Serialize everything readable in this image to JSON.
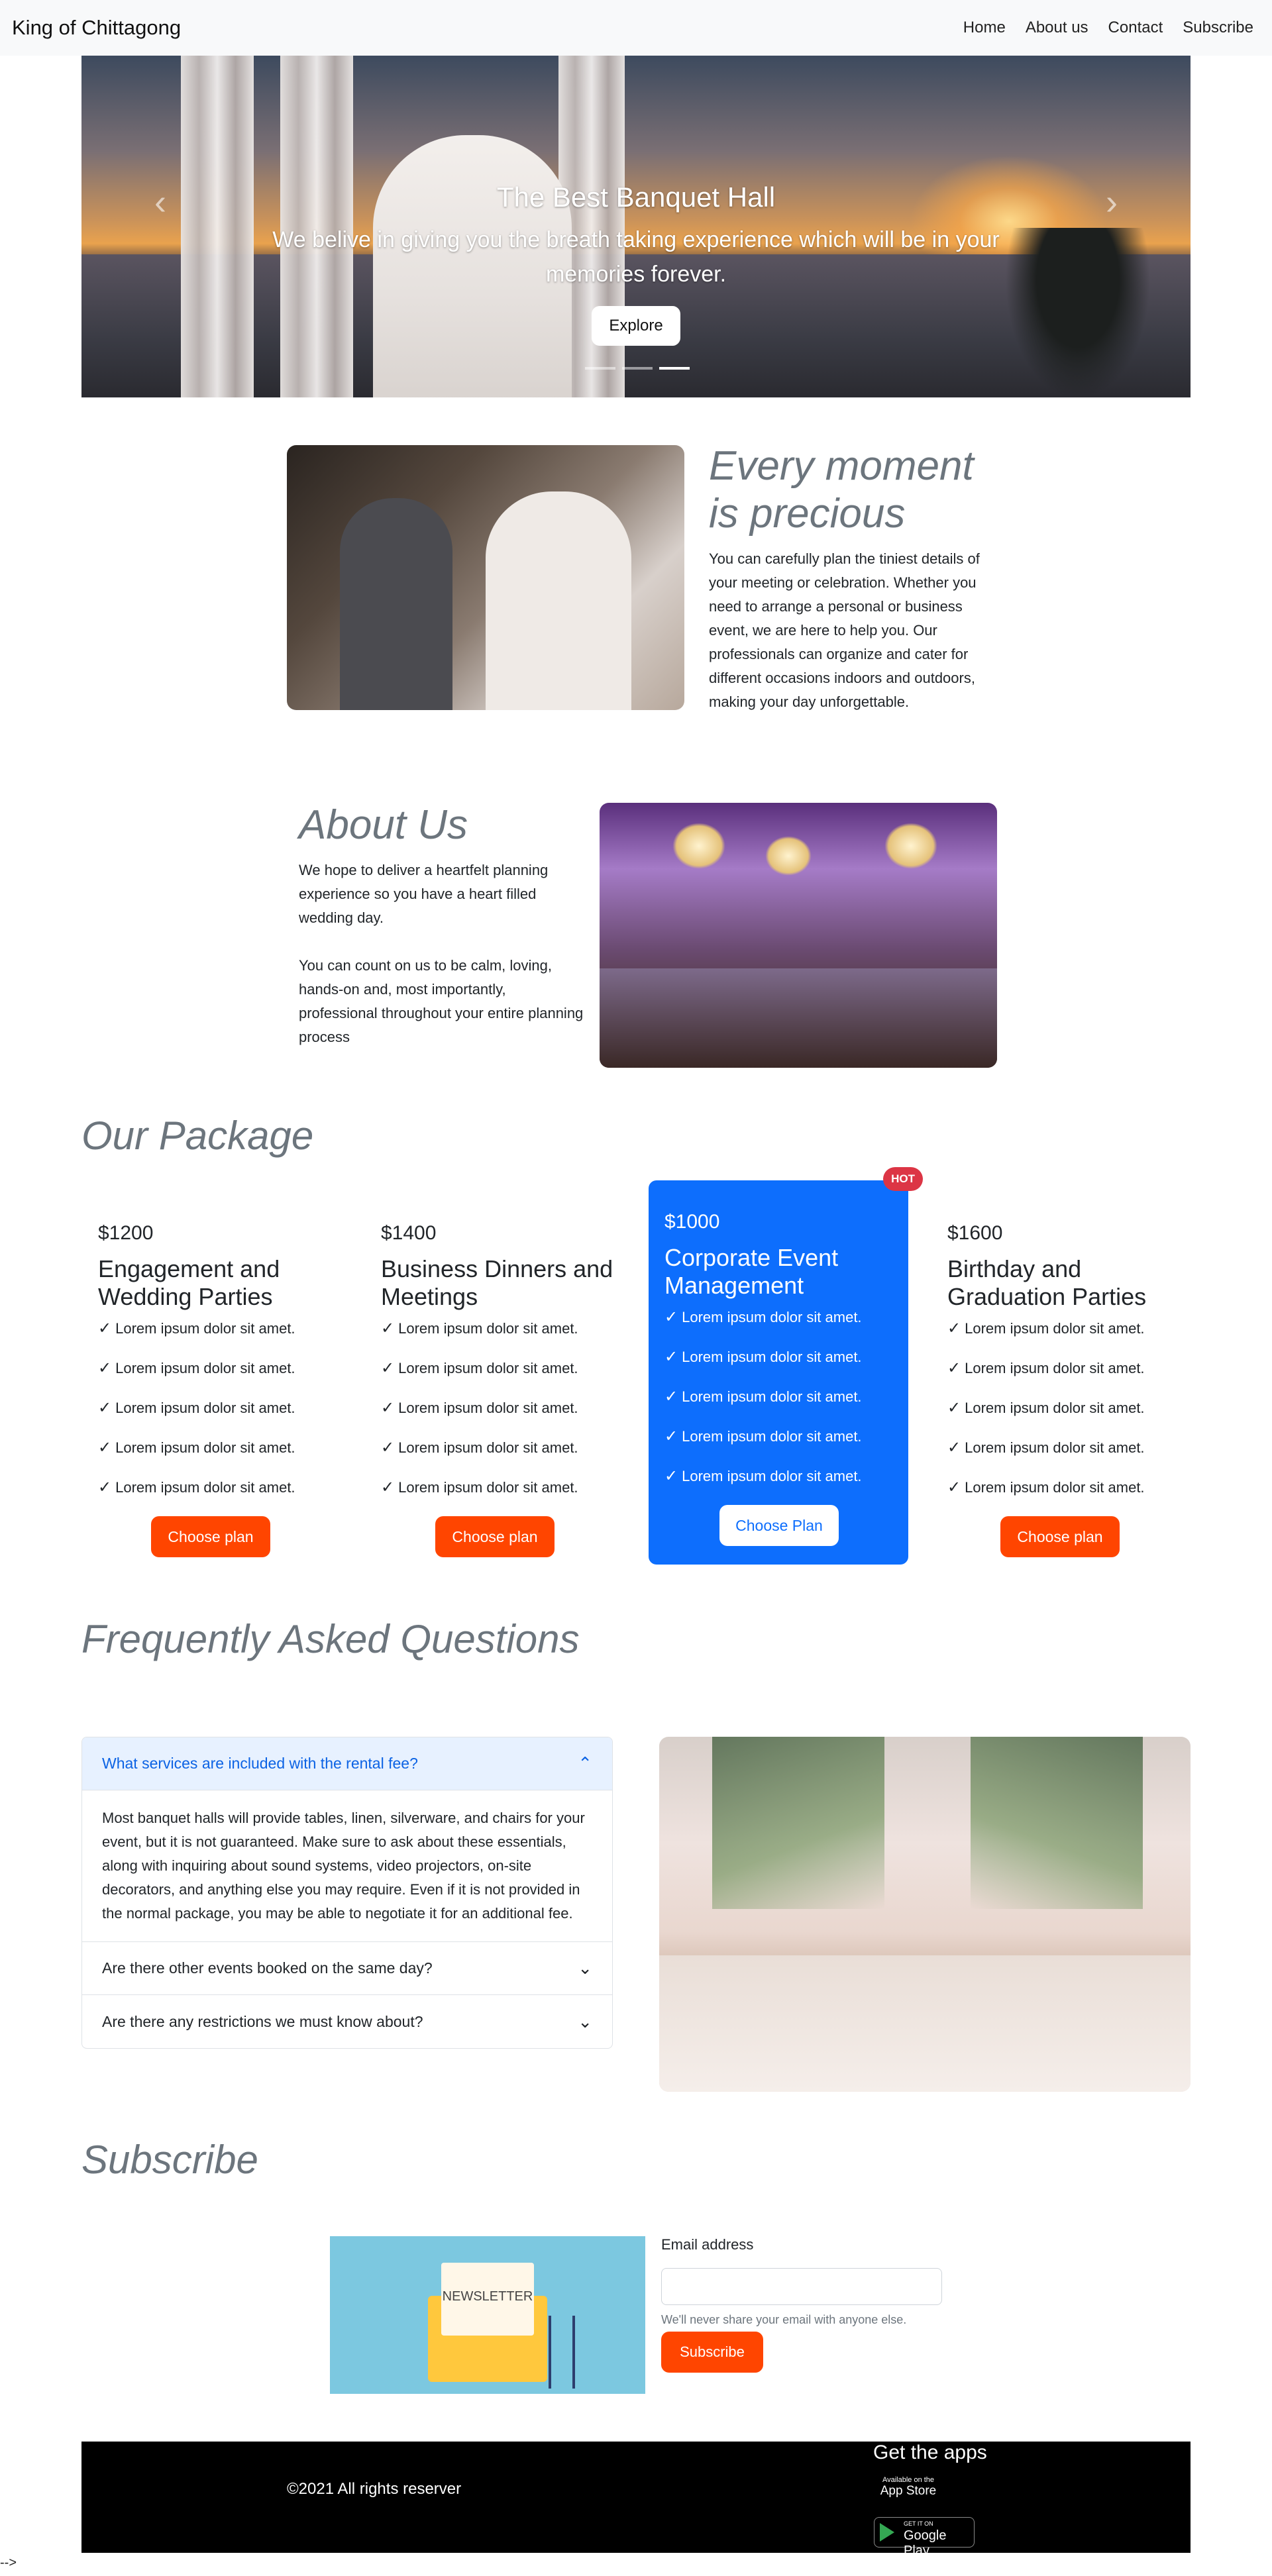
{
  "nav": {
    "brand": "King of Chittagong",
    "links": [
      "Home",
      "About us",
      "Contact",
      "Subscribe"
    ]
  },
  "hero": {
    "title": "The Best Banquet Hall",
    "subtitle": "We belive in giving you the breath taking experience which will be in your memories forever.",
    "button": "Explore",
    "prev_icon": "chevron-left-icon",
    "next_icon": "chevron-right-icon",
    "indicators": 3,
    "active_indicator": 3
  },
  "precious": {
    "heading": "Every moment is precious",
    "text": "You can carefully plan the tiniest details of your meeting or celebration. Whether you need to arrange a personal or business event, we are here to help you. Our professionals can organize and cater for different occasions indoors and outdoors, making your day unforgettable."
  },
  "about": {
    "heading": "About Us",
    "text1": "We hope to deliver a heartfelt planning experience so you have a heart filled wedding day.",
    "text2": "You can count on us to be calm, loving, hands-on and, most importantly, professional throughout your entire planning process"
  },
  "packages": {
    "heading": "Our Package",
    "feature": "Lorem ipsum dolor sit amet.",
    "items": [
      {
        "price": "$1200",
        "name": "Engagement and Wedding Parties",
        "button": "Choose plan"
      },
      {
        "price": "$1400",
        "name": "Business Dinners and Meetings",
        "button": "Choose plan"
      },
      {
        "price": "$1000",
        "name": "Corporate Event Management",
        "button": "Choose Plan",
        "badge": "HOT"
      },
      {
        "price": "$1600",
        "name": "Birthday and Graduation Parties",
        "button": "Choose plan"
      }
    ]
  },
  "faq": {
    "heading": "Frequently Asked Questions",
    "items": [
      {
        "q": "What services are included with the rental fee?",
        "a": "Most banquet halls will provide tables, linen, silverware, and chairs for your event, but it is not guaranteed. Make sure to ask about these essentials, along with inquiring about sound systems, video projectors, on-site decorators, and anything else you may require. Even if it is not provided in the normal package, you may be able to negotiate it for an additional fee."
      },
      {
        "q": "Are there other events booked on the same day?"
      },
      {
        "q": "Are there any restrictions we must know about?"
      }
    ]
  },
  "subscribe": {
    "heading": "Subscribe",
    "newsletter_label": "NEWSLETTER",
    "email_label": "Email address",
    "email_value": "",
    "help": "We'll never share your email with anyone else.",
    "button": "Subscribe"
  },
  "footer": {
    "copyright": "©2021 All rights reserver",
    "apps_title": "Get the apps",
    "appstore_small": "Available on the",
    "appstore_big": "App Store",
    "play_small": "GET IT ON",
    "play_big": "Google Play"
  },
  "trailing": "-->",
  "colors": {
    "accent": "#ff4500",
    "primary": "#0d6efd",
    "hot": "#dc3545"
  }
}
